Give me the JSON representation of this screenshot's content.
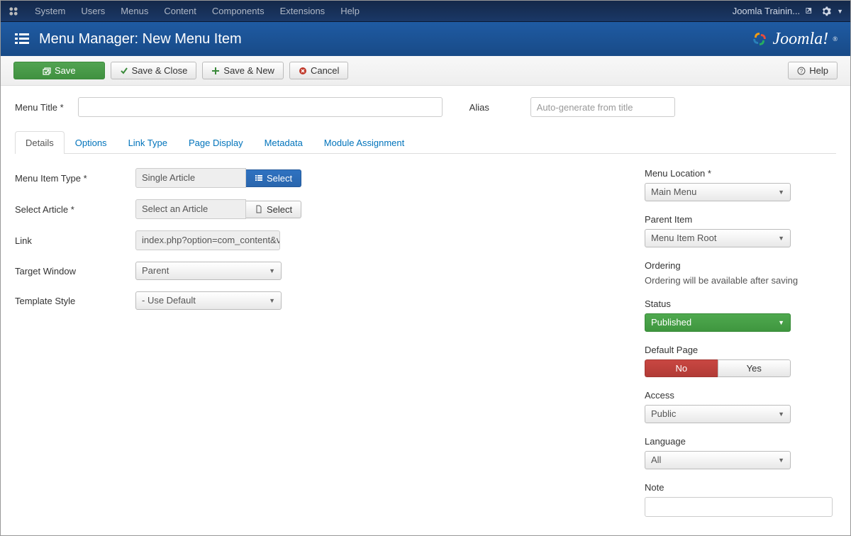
{
  "topnav": {
    "items": [
      "System",
      "Users",
      "Menus",
      "Content",
      "Components",
      "Extensions",
      "Help"
    ],
    "site_name": "Joomla Trainin..."
  },
  "titlebar": {
    "title": "Menu Manager: New Menu Item",
    "logo_text": "Joomla!"
  },
  "toolbar": {
    "save": "Save",
    "save_close": "Save & Close",
    "save_new": "Save & New",
    "cancel": "Cancel",
    "help": "Help"
  },
  "form": {
    "menu_title_label": "Menu Title *",
    "menu_title_value": "",
    "alias_label": "Alias",
    "alias_placeholder": "Auto-generate from title",
    "alias_value": ""
  },
  "tabs": [
    "Details",
    "Options",
    "Link Type",
    "Page Display",
    "Metadata",
    "Module Assignment"
  ],
  "details": {
    "menu_item_type_label": "Menu Item Type *",
    "menu_item_type_value": "Single Article",
    "select_btn": "Select",
    "select_article_label": "Select Article *",
    "select_article_value": "Select an Article",
    "link_label": "Link",
    "link_value": "index.php?option=com_content&vie",
    "target_window_label": "Target Window",
    "target_window_value": "Parent",
    "template_style_label": "Template Style",
    "template_style_value": "- Use Default"
  },
  "sidebar": {
    "menu_location_label": "Menu Location *",
    "menu_location_value": "Main Menu",
    "parent_item_label": "Parent Item",
    "parent_item_value": "Menu Item Root",
    "ordering_label": "Ordering",
    "ordering_hint": "Ordering will be available after saving",
    "status_label": "Status",
    "status_value": "Published",
    "default_page_label": "Default Page",
    "default_no": "No",
    "default_yes": "Yes",
    "access_label": "Access",
    "access_value": "Public",
    "language_label": "Language",
    "language_value": "All",
    "note_label": "Note",
    "note_value": ""
  }
}
